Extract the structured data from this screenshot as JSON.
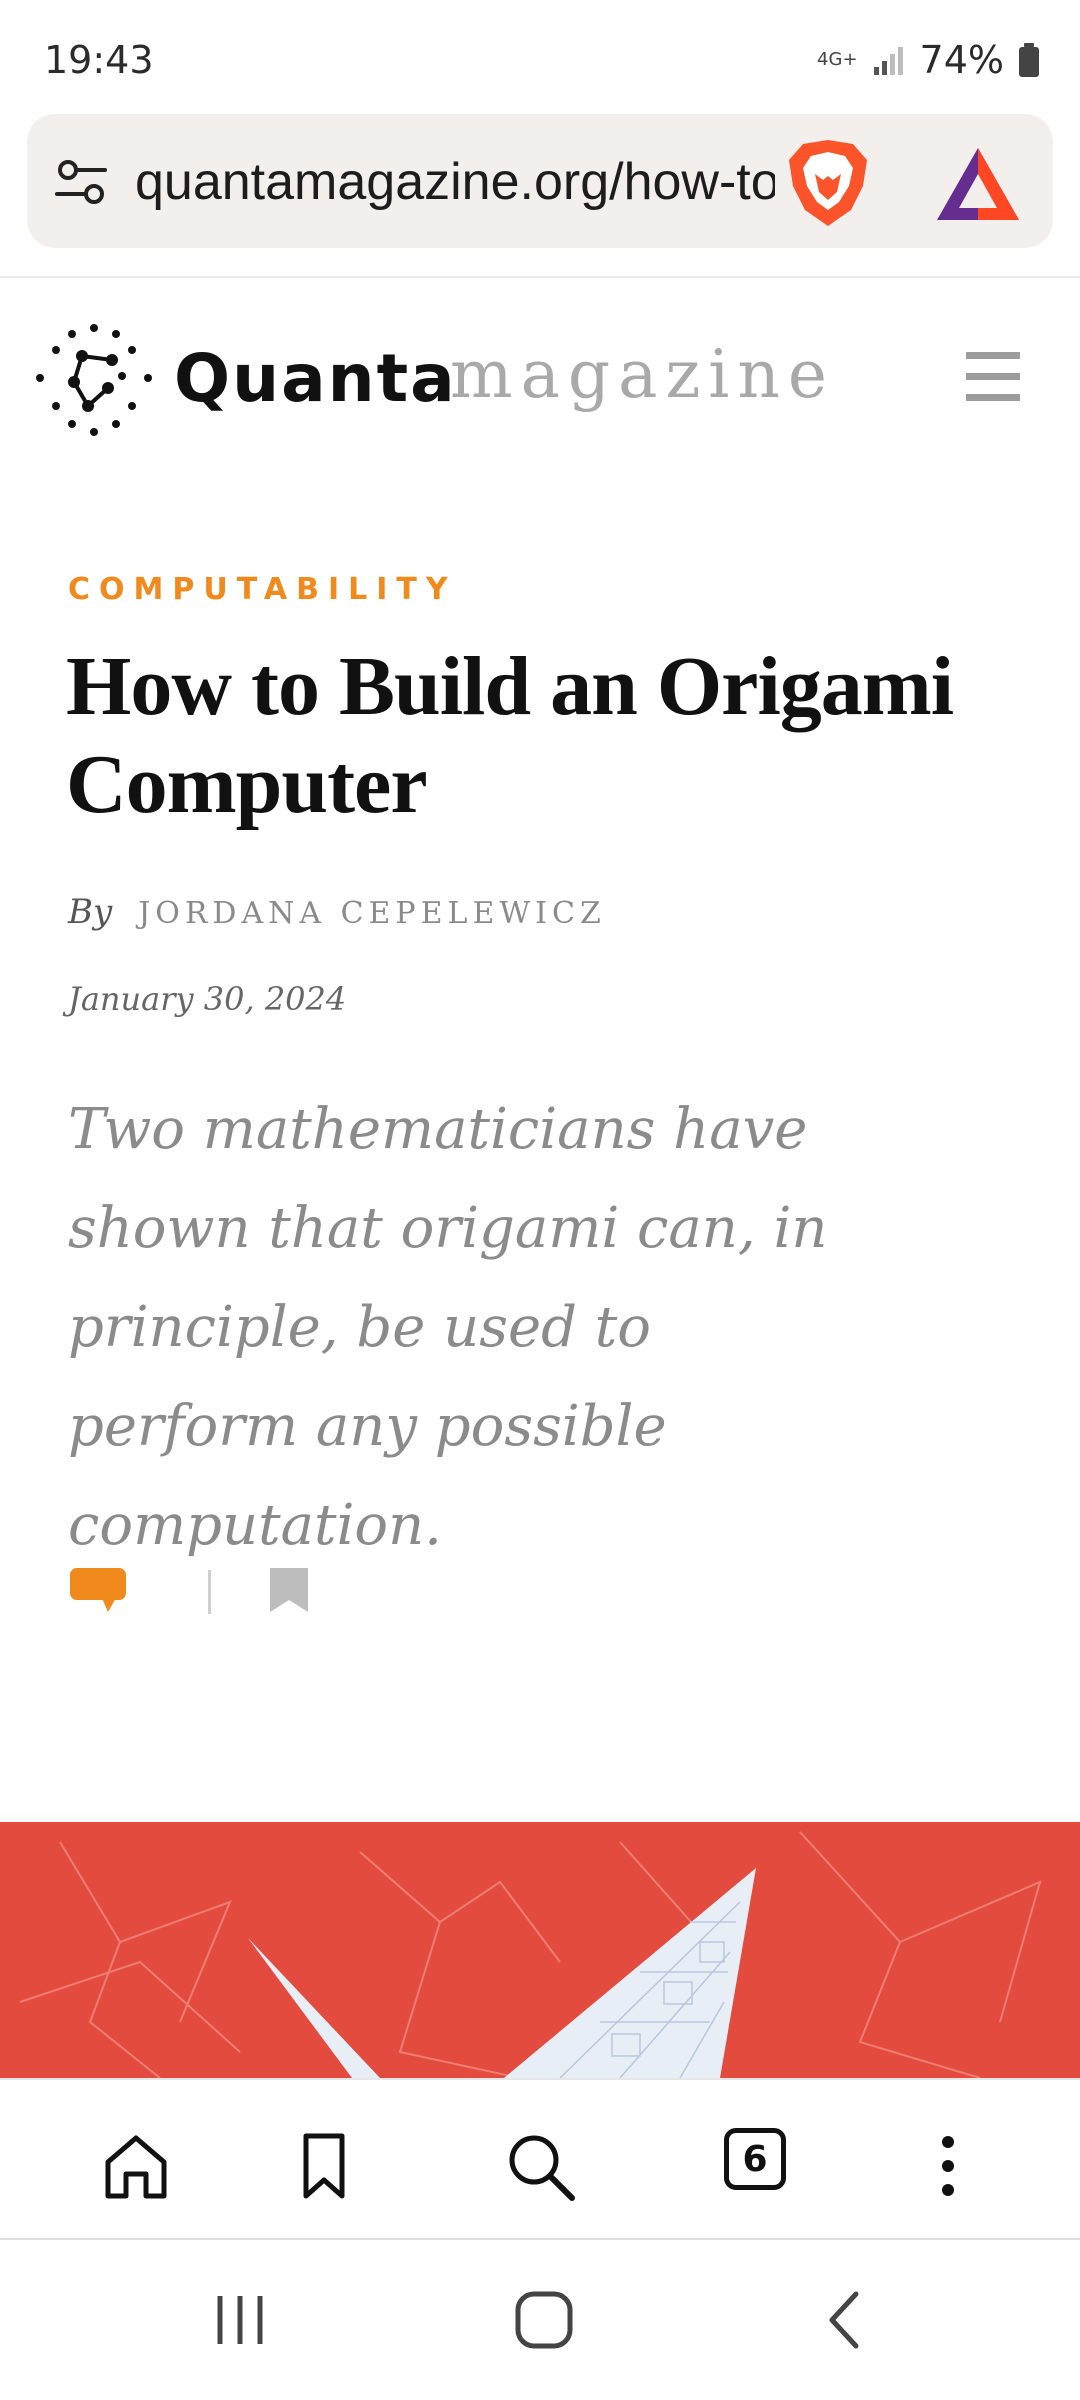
{
  "status_bar": {
    "time": "19:43",
    "network": "4G+",
    "battery": "74%"
  },
  "browser": {
    "url": "quantamagazine.org/how-to-build-an-origami-computer",
    "tab_count": "6",
    "colors": {
      "brave_orange": "#fb542b",
      "url_bar_bg": "#f2efed"
    }
  },
  "site": {
    "brand_bold": "Quanta",
    "brand_light": "magazine"
  },
  "article": {
    "kicker": "COMPUTABILITY",
    "title": "How to Build an Origami Computer",
    "byline_prefix": "By",
    "author": "JORDANA CEPELEWICZ",
    "date": "January 30, 2024",
    "dek": "Two mathematicians have shown that origami can, in principle, be used to perform any possible computation.",
    "colors": {
      "kicker": "#f08a1c",
      "hero_bg": "#e44b3f"
    }
  },
  "icons": {
    "url_bar": [
      "tune-icon",
      "brave-lion-icon",
      "brave-rewards-icon"
    ],
    "header": [
      "quanta-logo-icon",
      "menu-icon"
    ],
    "article": [
      "comment-icon",
      "bookmark-icon"
    ],
    "toolbar": [
      "home-icon",
      "bookmarks-icon",
      "search-icon",
      "tabs-icon",
      "more-icon"
    ],
    "system_nav": [
      "recents-icon",
      "home-nav-icon",
      "back-icon"
    ]
  }
}
